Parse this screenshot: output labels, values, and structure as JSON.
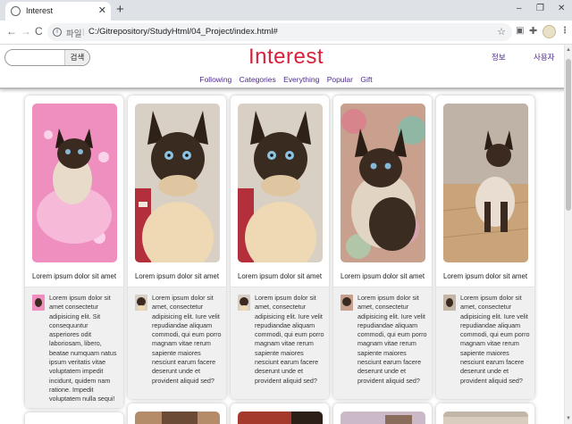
{
  "browser": {
    "tab_title": "Interest",
    "new_tab": "+",
    "tab_close": "✕",
    "nav_back": "←",
    "nav_forward": "→",
    "nav_reload": "C",
    "scheme_label": "파일",
    "url": "C:/Gitrepository/StudyHtml/04_Project/index.html#",
    "window_controls": [
      "–",
      "❐",
      "✕"
    ]
  },
  "header": {
    "search_placeholder": "",
    "search_button": "검색",
    "logo": "Interest",
    "info_link": "정보",
    "user_link": "사용자"
  },
  "nav": {
    "items": [
      "Following",
      "Categories",
      "Everything",
      "Popular",
      "Gift"
    ]
  },
  "cards": [
    {
      "title": "Lorem ipsum dolor sit amet",
      "body": "Lorem ipsum dolor sit amet consectetur adipisicing elit. Sit consequuntur asperiores odit laboriosam, libero, beatae numquam natus ipsum veritatis vitae voluptatem impedit incidunt, quidem nam ratione. Impedit voluptatem nulla sequi!"
    },
    {
      "title": "Lorem ipsum dolor sit amet",
      "body": "Lorem ipsum dolor sit amet, consectetur adipisicing elit. Iure velit repudiandae aliquam commodi, qui eum porro magnam vitae rerum sapiente maiores nesciunt earum facere deserunt unde et provident aliquid sed?"
    },
    {
      "title": "Lorem ipsum dolor sit amet",
      "body": "Lorem ipsum dolor sit amet, consectetur adipisicing elit. Iure velit repudiandae aliquam commodi, qui eum porro magnam vitae rerum sapiente maiores nesciunt earum facere deserunt unde et provident aliquid sed?"
    },
    {
      "title": "Lorem ipsum dolor sit amet",
      "body": "Lorem ipsum dolor sit amet, consectetur adipisicing elit. Iure velit repudiandae aliquam commodi, qui eum porro magnam vitae rerum sapiente maiores nesciunt earum facere deserunt unde et provident aliquid sed?"
    },
    {
      "title": "Lorem ipsum dolor sit amet",
      "body": "Lorem ipsum dolor sit amet, consectetur adipisicing elit. Iure velit repudiandae aliquam commodi, qui eum porro magnam vitae rerum sapiente maiores nesciunt earum facere deserunt unde et provident aliquid sed?"
    }
  ],
  "colors": {
    "logo": "#d6213b",
    "nav_link": "#4d2a8c"
  }
}
